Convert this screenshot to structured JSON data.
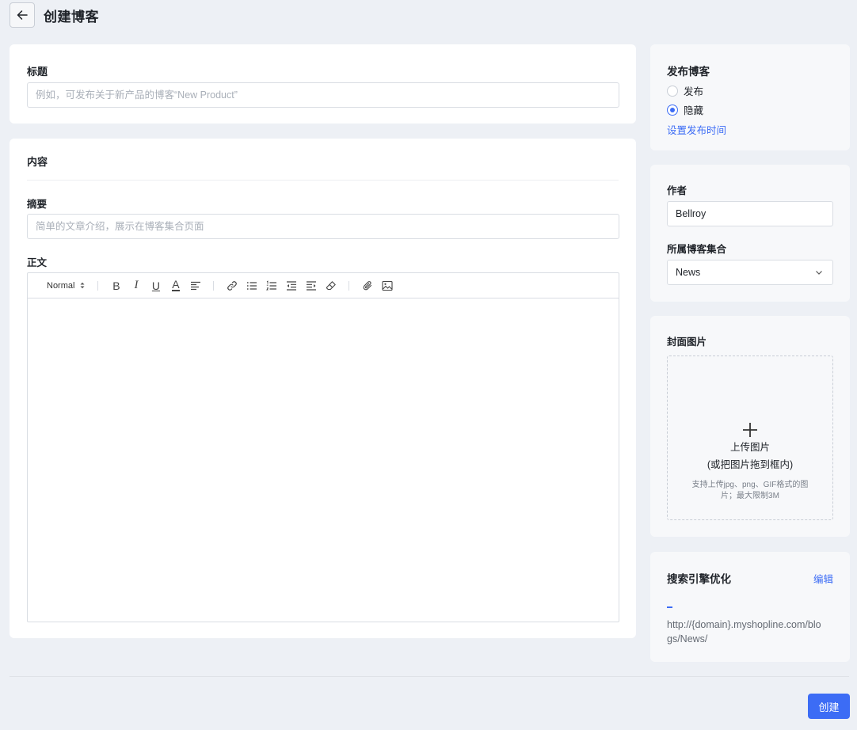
{
  "header": {
    "title": "创建博客"
  },
  "title_section": {
    "label": "标题",
    "placeholder": "例如，可发布关于新产品的博客“New Product”"
  },
  "content_section": {
    "heading": "内容",
    "summary_label": "摘要",
    "summary_placeholder": "简单的文章介绍，展示在博客集合页面",
    "body_label": "正文",
    "toolbar": {
      "format_select": "Normal",
      "bold": "B",
      "italic": "I",
      "underline": "U",
      "font_color": "A"
    }
  },
  "publish": {
    "heading": "发布博客",
    "options": [
      {
        "label": "发布",
        "checked": false
      },
      {
        "label": "隐藏",
        "checked": true
      }
    ],
    "schedule_link": "设置发布时间"
  },
  "author": {
    "label": "作者",
    "value": "Bellroy",
    "collection_label": "所属博客集合",
    "collection_value": "News"
  },
  "cover": {
    "heading": "封面图片",
    "upload_title": "上传图片",
    "upload_hint": "(或把图片拖到框内)",
    "upload_note": "支持上传jpg、png、GIF格式的图片；最大限制3M"
  },
  "seo": {
    "heading": "搜索引擎优化",
    "edit_link": "编辑",
    "title_placeholder": "–",
    "url": "http://{domain}.myshopline.com/blogs/News/"
  },
  "footer": {
    "create_button": "创建"
  },
  "colors": {
    "accent": "#3c6cf5",
    "background": "#edf0f5"
  }
}
